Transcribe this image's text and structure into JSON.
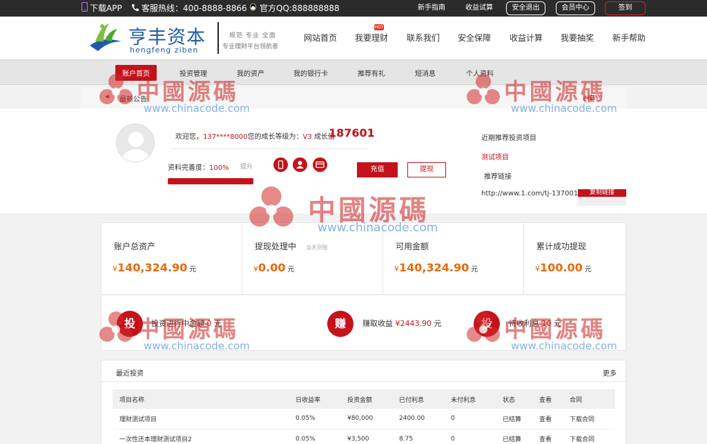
{
  "topbar": {
    "app": "下载APP",
    "hotline": "客服热线：400-8888-8866",
    "qq": "官方QQ:888888888",
    "links": [
      "新手指南",
      "收益试算"
    ],
    "buttons": [
      "安全退出",
      "会员中心",
      "签到"
    ]
  },
  "header": {
    "logo_cn": "亨丰资本",
    "logo_en": "hengfeng ziben",
    "slogan1": "规范 专业 全面",
    "slogan2": "专业理财平台领航者",
    "nav": [
      "网站首页",
      "我要理财",
      "联系我们",
      "安全保障",
      "收益计算",
      "我要抽奖",
      "新手帮助"
    ],
    "hot_badge": "HOT"
  },
  "subnav": [
    "账户首页",
    "投资管理",
    "我的资产",
    "我的银行卡",
    "推荐有礼",
    "短消息",
    "个人资料"
  ],
  "notice": {
    "label": "最新公告",
    "more": "《保"
  },
  "profile": {
    "welcome_prefix": "欢迎您，",
    "phone": "137****8000",
    "welcome_mid": "您的成长等级为：",
    "level": "V3",
    "growth_label": "成长值",
    "growth_value": "187601",
    "complete_label": "资料完善度：",
    "complete_value": "100%",
    "complete_fraction": 1.0,
    "raise": "提升",
    "icons": [
      "phone-icon",
      "user-icon",
      "card-icon"
    ],
    "recharge": "充值",
    "withdraw": "提现",
    "rec_title": "近期推荐投资项目",
    "rec_item": "测试项目",
    "rec_link_label": "推荐链接",
    "rec_url": "http://www.1.com/tj-13700138...",
    "copy": "复制链接"
  },
  "stats": [
    {
      "label": "账户总资产",
      "sub": "",
      "currency": "¥",
      "value": "140,324.90",
      "unit": "元"
    },
    {
      "label": "提现处理中",
      "sub": "当天到账",
      "currency": "¥",
      "value": "0.00",
      "unit": "元"
    },
    {
      "label": "可用金额",
      "sub": "",
      "currency": "¥",
      "value": "140,324.90",
      "unit": "元"
    },
    {
      "label": "累计成功提现",
      "sub": "",
      "currency": "¥",
      "value": "100.00",
      "unit": "元"
    }
  ],
  "invest_summary": [
    {
      "badge": "投",
      "label": "投资进行中金额",
      "value": "0",
      "unit": "元"
    },
    {
      "badge": "赚",
      "label": "赚取收益",
      "value": "¥2443.90",
      "unit": "元"
    },
    {
      "badge": "投",
      "label": "待收利息",
      "value": "10",
      "unit": "元"
    }
  ],
  "recent": {
    "title": "最近投资",
    "more": "更多",
    "columns": [
      "项目名称",
      "日收益率",
      "投资金额",
      "已付利息",
      "未付利息",
      "状态",
      "查看",
      "合同"
    ],
    "rows": [
      [
        "理财测试项目",
        "0.05%",
        "¥80,000",
        "2400.00",
        "0",
        "已结算",
        "查看",
        "下载合同"
      ],
      [
        "一次性还本理财测试项目2",
        "0.05%",
        "¥3,500",
        "8.75",
        "0",
        "已结算",
        "查看",
        "下载合同"
      ]
    ]
  },
  "watermark": {
    "cn": "中國源碼",
    "en": "www.chinacode.com"
  },
  "colors": {
    "brand_red": "#c4121b",
    "accent_orange": "#e86a0a",
    "topbar_bg": "#2b2b2b",
    "logo_blue": "#1e5aa8"
  }
}
